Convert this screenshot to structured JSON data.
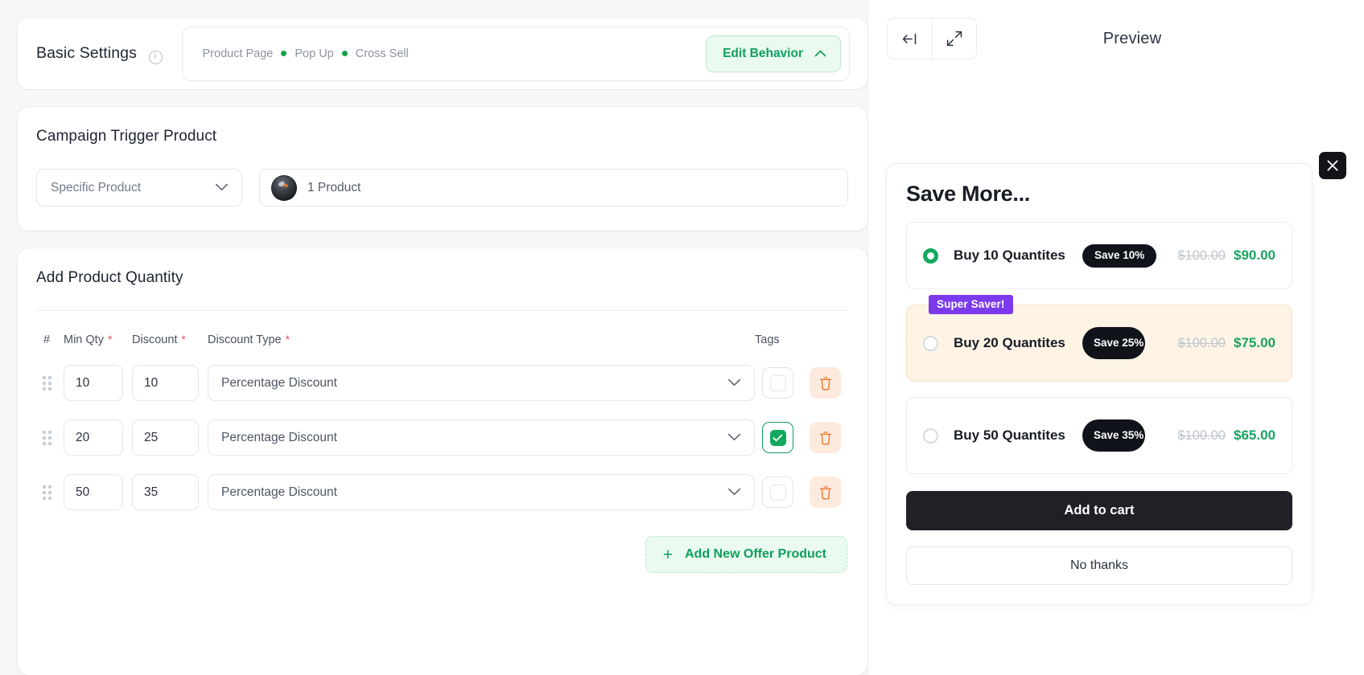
{
  "basic": {
    "title": "Basic Settings",
    "info_icon": "info-icon",
    "chips": [
      "Product Page",
      "Pop Up",
      "Cross Sell"
    ],
    "edit_behavior_label": "Edit Behavior",
    "chevron_icon": "chevron-up-icon",
    "accent": "#10a05e"
  },
  "trigger": {
    "title": "Campaign Trigger Product",
    "select_value": "Specific Product",
    "select_chevron": "chevron-down-icon",
    "product_label": "1 Product",
    "avatar_icon": "product-thumbnail"
  },
  "quantity": {
    "title": "Add Product Quantity",
    "columns": {
      "hash": "#",
      "min_qty": "Min Qty",
      "discount": "Discount",
      "discount_type": "Discount Type",
      "tags": "Tags",
      "required_mark": "*"
    },
    "rows": [
      {
        "min_qty": "10",
        "discount": "10",
        "discount_type": "Percentage Discount",
        "tag_checked": false
      },
      {
        "min_qty": "20",
        "discount": "25",
        "discount_type": "Percentage Discount",
        "tag_checked": true
      },
      {
        "min_qty": "50",
        "discount": "35",
        "discount_type": "Percentage Discount",
        "tag_checked": false
      }
    ],
    "add_button_label": "Add New Offer Product",
    "add_button_icon": "plus-icon",
    "plus": "+",
    "delete_icon": "trash-icon",
    "drag_icon": "drag-handle-icon"
  },
  "preview": {
    "title": "Preview",
    "collapse_icon": "collapse-left-icon",
    "expand_icon": "expand-fullscreen-icon",
    "close_icon": "close-icon",
    "modal": {
      "heading": "Save More...",
      "offers": [
        {
          "label": "Buy 10 Quantites",
          "save_badge": "Save 10%",
          "price_old": "$100.00",
          "price_new": "$90.00",
          "selected": true,
          "highlight": false,
          "ribbon": ""
        },
        {
          "label": "Buy 20 Quantites",
          "save_badge": "Save 25%",
          "price_old": "$100.00",
          "price_new": "$75.00",
          "selected": false,
          "highlight": true,
          "ribbon": "Super Saver!"
        },
        {
          "label": "Buy 50 Quantites",
          "save_badge": "Save 35%",
          "price_old": "$100.00",
          "price_new": "$65.00",
          "selected": false,
          "highlight": false,
          "ribbon": ""
        }
      ],
      "add_to_cart_label": "Add to cart",
      "no_thanks_label": "No thanks"
    }
  },
  "colors": {
    "green": "#12a95f",
    "green_light_bg": "#eafaf0",
    "purple": "#7c3aed",
    "dark": "#1f2127",
    "highlight_bg": "#fdf4e6",
    "danger_bg": "#fdeade",
    "danger": "#e8762a"
  }
}
